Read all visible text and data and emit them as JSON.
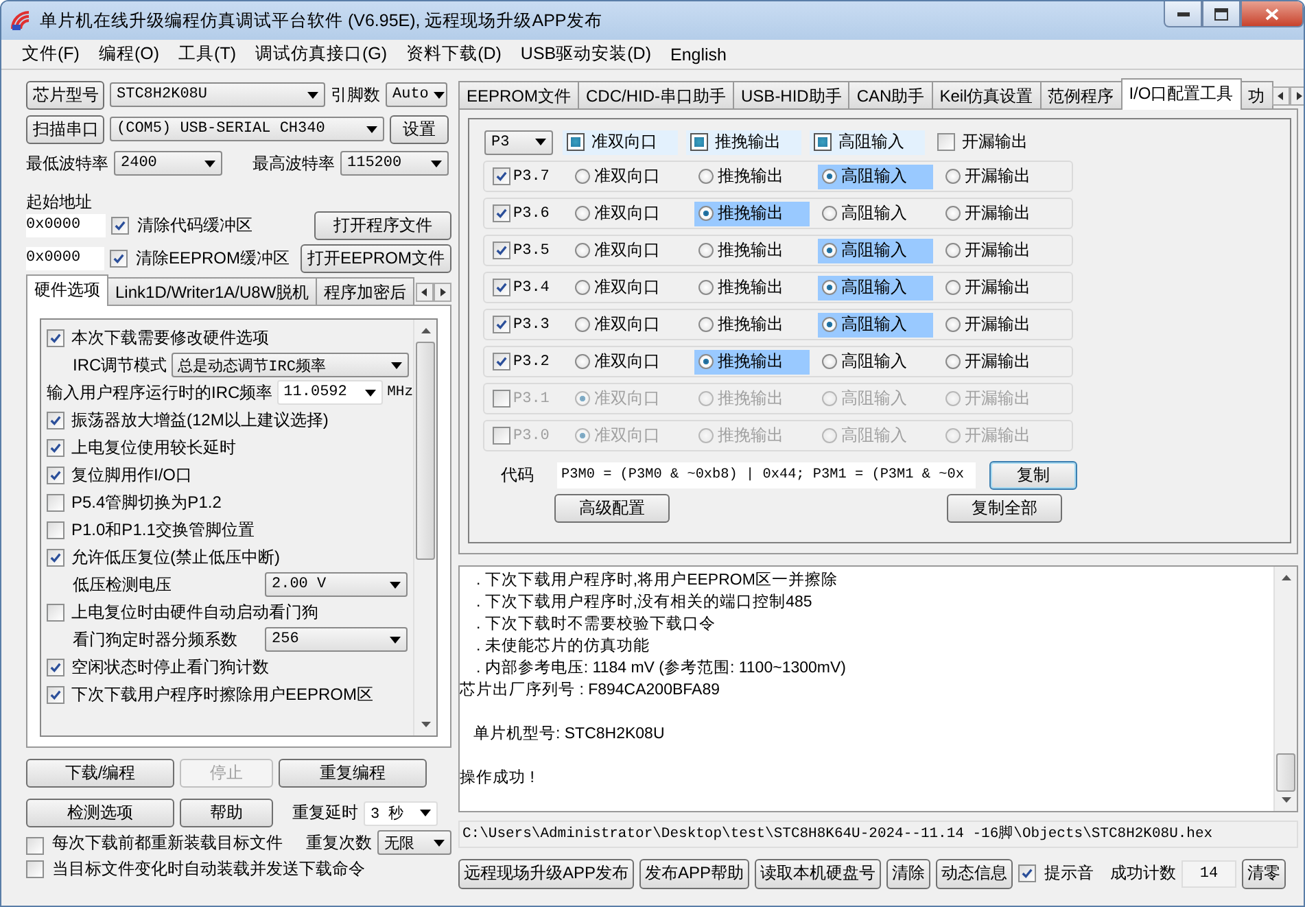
{
  "window": {
    "title": "单片机在线升级编程仿真调试平台软件 (V6.95E), 远程现场升级APP发布"
  },
  "menu": [
    "文件(F)",
    "编程(O)",
    "工具(T)",
    "调试仿真接口(G)",
    "资料下载(D)",
    "USB驱动安装(D)",
    "English"
  ],
  "chip": {
    "button": "芯片型号",
    "value": "STC8H2K08U",
    "pins_label": "引脚数",
    "pins_value": "Auto"
  },
  "port": {
    "button": "扫描串口",
    "value": "(COM5) USB-SERIAL CH340",
    "settings_button": "设置"
  },
  "baud": {
    "min_label": "最低波特率",
    "min_value": "2400",
    "max_label": "最高波特率",
    "max_value": "115200"
  },
  "start_address_label": "起始地址",
  "address_rows": [
    {
      "value": "0x0000",
      "label": "清除代码缓冲区",
      "checked": true,
      "button": "打开程序文件"
    },
    {
      "value": "0x0000",
      "label": "清除EEPROM缓冲区",
      "checked": true,
      "button": "打开EEPROM文件"
    }
  ],
  "left_tabs": [
    {
      "label": "硬件选项",
      "selected": true
    },
    {
      "label": "Link1D/Writer1A/U8W脱机",
      "selected": false
    },
    {
      "label": "程序加密后",
      "selected": false
    }
  ],
  "options": [
    {
      "kind": "check",
      "label": "本次下载需要修改硬件选项",
      "checked": true
    },
    {
      "kind": "select",
      "label": "IRC调节模式",
      "value": "总是动态调节IRC频率"
    },
    {
      "kind": "combo",
      "label": "输入用户程序运行时的IRC频率",
      "value": "11.0592",
      "unit": "MHz"
    },
    {
      "kind": "check",
      "label": "振荡器放大增益(12M以上建议选择)",
      "checked": true
    },
    {
      "kind": "check",
      "label": "上电复位使用较长延时",
      "checked": true
    },
    {
      "kind": "check",
      "label": "复位脚用作I/O口",
      "checked": true
    },
    {
      "kind": "check",
      "label": "P5.4管脚切换为P1.2",
      "checked": false
    },
    {
      "kind": "check",
      "label": "P1.0和P1.1交换管脚位置",
      "checked": false
    },
    {
      "kind": "check",
      "label": "允许低压复位(禁止低压中断)",
      "checked": true
    },
    {
      "kind": "select",
      "label": "低压检测电压",
      "value": "2.00 V"
    },
    {
      "kind": "check",
      "label": "上电复位时由硬件自动启动看门狗",
      "checked": false
    },
    {
      "kind": "select",
      "label": "看门狗定时器分频系数",
      "value": "256"
    },
    {
      "kind": "check",
      "label": "空闲状态时停止看门狗计数",
      "checked": true
    },
    {
      "kind": "check",
      "label": "下次下载用户程序时擦除用户EEPROM区",
      "checked": true
    }
  ],
  "actions": [
    {
      "label": "下载/编程",
      "disabled": false
    },
    {
      "label": "停止",
      "disabled": true
    },
    {
      "label": "重复编程",
      "disabled": false
    },
    {
      "label": "检测选项",
      "disabled": false
    },
    {
      "label": "帮助",
      "disabled": false
    }
  ],
  "repeat_delay": {
    "label": "重复延时",
    "value": "3 秒"
  },
  "repeat_count": {
    "label": "重复次数",
    "value": "无限"
  },
  "bottom_checks": [
    {
      "label": "每次下载前都重新装载目标文件",
      "checked": false
    },
    {
      "label": "当目标文件变化时自动装载并发送下载命令",
      "checked": false
    }
  ],
  "right_tabs": [
    {
      "label": "EEPROM文件",
      "selected": false
    },
    {
      "label": "CDC/HID-串口助手",
      "selected": false
    },
    {
      "label": "USB-HID助手",
      "selected": false
    },
    {
      "label": "CAN助手",
      "selected": false
    },
    {
      "label": "Keil仿真设置",
      "selected": false
    },
    {
      "label": "范例程序",
      "selected": false
    },
    {
      "label": "I/O口配置工具",
      "selected": true
    },
    {
      "label": "功",
      "selected": false
    }
  ],
  "io": {
    "port": "P3",
    "header": [
      {
        "label": "准双向口",
        "indeterminate": true
      },
      {
        "label": "推挽输出",
        "indeterminate": true
      },
      {
        "label": "高阻输入",
        "indeterminate": true
      },
      {
        "label": "开漏输出",
        "indeterminate": false
      }
    ],
    "pins": [
      {
        "name": "P3.7",
        "checked": true,
        "modes": [
          {
            "label": "准双向口",
            "selected": false
          },
          {
            "label": "推挽输出",
            "selected": false
          },
          {
            "label": "高阻输入",
            "selected": true
          },
          {
            "label": "开漏输出",
            "selected": false
          }
        ]
      },
      {
        "name": "P3.6",
        "checked": true,
        "modes": [
          {
            "label": "准双向口",
            "selected": false
          },
          {
            "label": "推挽输出",
            "selected": true
          },
          {
            "label": "高阻输入",
            "selected": false
          },
          {
            "label": "开漏输出",
            "selected": false
          }
        ]
      },
      {
        "name": "P3.5",
        "checked": true,
        "modes": [
          {
            "label": "准双向口",
            "selected": false
          },
          {
            "label": "推挽输出",
            "selected": false
          },
          {
            "label": "高阻输入",
            "selected": true
          },
          {
            "label": "开漏输出",
            "selected": false
          }
        ]
      },
      {
        "name": "P3.4",
        "checked": true,
        "modes": [
          {
            "label": "准双向口",
            "selected": false
          },
          {
            "label": "推挽输出",
            "selected": false
          },
          {
            "label": "高阻输入",
            "selected": true
          },
          {
            "label": "开漏输出",
            "selected": false
          }
        ]
      },
      {
        "name": "P3.3",
        "checked": true,
        "modes": [
          {
            "label": "准双向口",
            "selected": false
          },
          {
            "label": "推挽输出",
            "selected": false
          },
          {
            "label": "高阻输入",
            "selected": true
          },
          {
            "label": "开漏输出",
            "selected": false
          }
        ]
      },
      {
        "name": "P3.2",
        "checked": true,
        "modes": [
          {
            "label": "准双向口",
            "selected": false
          },
          {
            "label": "推挽输出",
            "selected": true
          },
          {
            "label": "高阻输入",
            "selected": false
          },
          {
            "label": "开漏输出",
            "selected": false
          }
        ]
      },
      {
        "name": "P3.1",
        "checked": false,
        "modes": [
          {
            "label": "准双向口",
            "selected": true
          },
          {
            "label": "推挽输出",
            "selected": false
          },
          {
            "label": "高阻输入",
            "selected": false
          },
          {
            "label": "开漏输出",
            "selected": false
          }
        ]
      },
      {
        "name": "P3.0",
        "checked": false,
        "modes": [
          {
            "label": "准双向口",
            "selected": true
          },
          {
            "label": "推挽输出",
            "selected": false
          },
          {
            "label": "高阻输入",
            "selected": false
          },
          {
            "label": "开漏输出",
            "selected": false
          }
        ]
      }
    ],
    "code_label": "代码",
    "code": "P3M0 = (P3M0 & ~0xb8) | 0x44; P3M1 = (P3M1 & ~0x",
    "copy_button": "复制",
    "advanced_button": "高级配置",
    "copy_all_button": "复制全部"
  },
  "log": [
    {
      "kind": "bullet",
      "text": ". 下次下载用户程序时,将用户EEPROM区一并擦除"
    },
    {
      "kind": "bullet",
      "text": ". 下次下载用户程序时,没有相关的端口控制485"
    },
    {
      "kind": "bullet",
      "text": ". 下次下载时不需要校验下载口令"
    },
    {
      "kind": "bullet",
      "text": ". 未使能芯片的仿真功能"
    },
    {
      "kind": "bullet",
      "text": ". 内部参考电压: 1184 mV (参考范围: 1100~1300mV)"
    },
    {
      "kind": "plain",
      "text": "芯片出厂序列号 : F894CA200BFA89"
    },
    {
      "kind": "spaced",
      "text": "单片机型号: STC8H2K08U"
    },
    {
      "kind": "plain",
      "text": "操作成功 !"
    }
  ],
  "path": "C:\\Users\\Administrator\\Desktop\\test\\STC8H8K64U-2024--11.14 -16脚\\Objects\\STC8H2K08U.hex",
  "bottom_buttons": [
    "远程现场升级APP发布",
    "发布APP帮助",
    "读取本机硬盘号",
    "清除",
    "动态信息"
  ],
  "beep": {
    "label": "提示音",
    "checked": true
  },
  "success": {
    "label": "成功计数",
    "value": "14",
    "clear_button": "清零"
  }
}
